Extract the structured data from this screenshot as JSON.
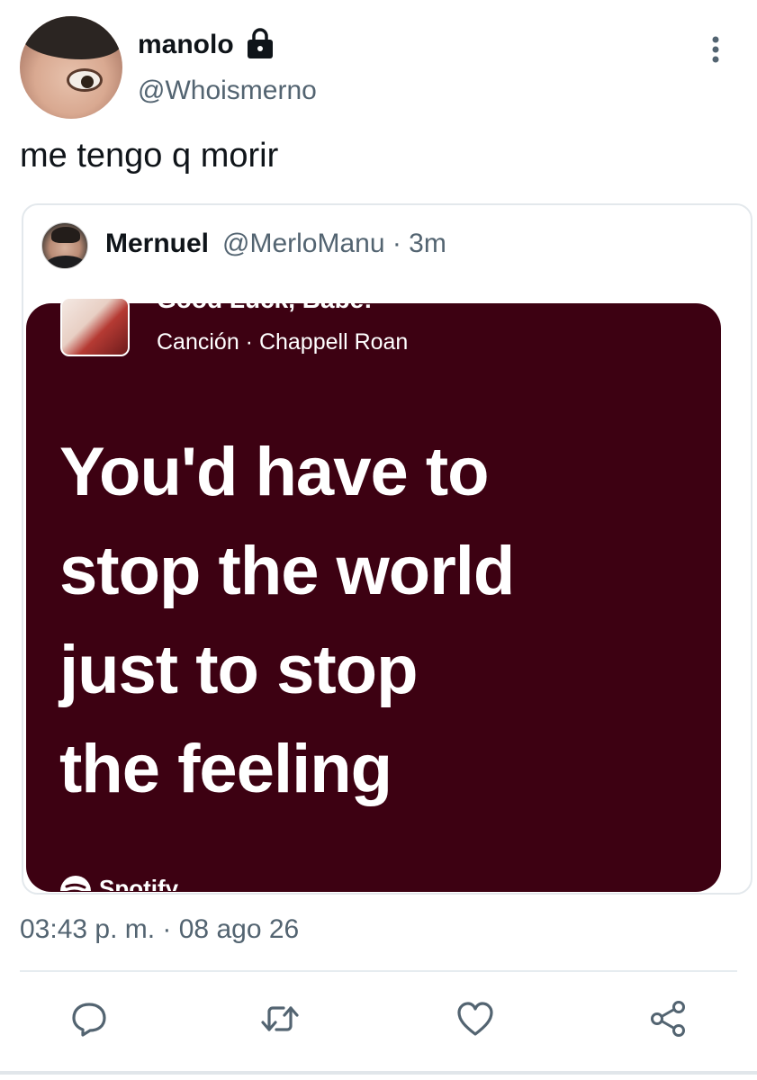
{
  "tweet": {
    "display_name": "manolo",
    "handle": "@Whoismerno",
    "text": "me tengo q morir",
    "timestamp": "03:43 p. m. · 08 ago 26",
    "icons": {
      "lock": "lock-icon",
      "more": "more-vertical-icon"
    }
  },
  "quote": {
    "display_name": "Mernuel",
    "handle_time": "@MerloManu · 3m",
    "media": {
      "song_title": "Good Luck, Babe!",
      "song_subtitle": "Canción · Chappell Roan",
      "lyrics": [
        "You'd have to",
        "stop the world",
        "just to stop",
        "the feeling"
      ],
      "brand": "Spotify",
      "background_color": "#3d0112"
    }
  },
  "actions": [
    {
      "name": "reply",
      "icon": "reply-icon"
    },
    {
      "name": "retweet",
      "icon": "retweet-icon"
    },
    {
      "name": "like",
      "icon": "heart-icon"
    },
    {
      "name": "share",
      "icon": "share-icon"
    }
  ],
  "colors": {
    "primary_text": "#0f1419",
    "secondary_text": "#536471",
    "border": "#e3e8ec"
  }
}
